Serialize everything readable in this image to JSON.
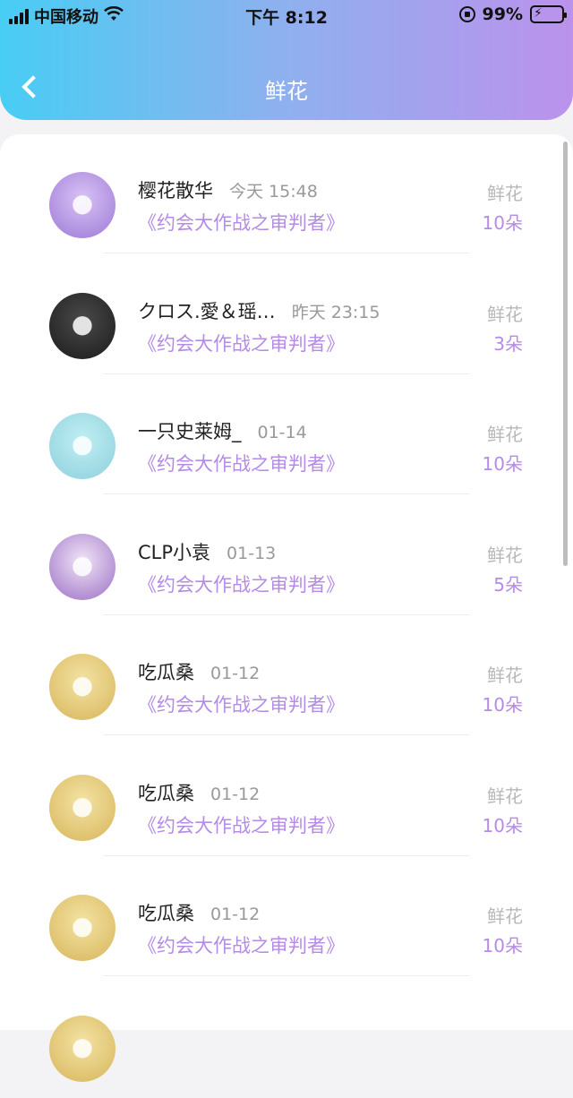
{
  "status": {
    "carrier": "中国移动",
    "time": "下午 8:12",
    "battery": "99%",
    "battery_level": 0.99
  },
  "nav": {
    "title": "鲜花"
  },
  "rows": [
    {
      "name": "樱花散华",
      "time": "今天 15:48",
      "gift": "《约会大作战之审判者》",
      "gift_label": "鲜花",
      "count": "10朵",
      "avatar_colors": [
        "#d9c3f5",
        "#9b78d6"
      ]
    },
    {
      "name": "クロス.愛＆瑶…",
      "time": "昨天 23:15",
      "gift": "《约会大作战之审判者》",
      "gift_label": "鲜花",
      "count": "3朵",
      "avatar_colors": [
        "#4a4a4a",
        "#1b1b1b"
      ]
    },
    {
      "name": "一只史莱姆_",
      "time": "01-14",
      "gift": "《约会大作战之审判者》",
      "gift_label": "鲜花",
      "count": "10朵",
      "avatar_colors": [
        "#bfeff3",
        "#8fcfdc"
      ]
    },
    {
      "name": "CLP小袁",
      "time": "01-13",
      "gift": "《约会大作战之审判者》",
      "gift_label": "鲜花",
      "count": "5朵",
      "avatar_colors": [
        "#f1e4f7",
        "#9a6fc4"
      ]
    },
    {
      "name": "吃瓜桑",
      "time": "01-12",
      "gift": "《约会大作战之审判者》",
      "gift_label": "鲜花",
      "count": "10朵",
      "avatar_colors": [
        "#f4e3a4",
        "#d6b55a"
      ]
    },
    {
      "name": "吃瓜桑",
      "time": "01-12",
      "gift": "《约会大作战之审判者》",
      "gift_label": "鲜花",
      "count": "10朵",
      "avatar_colors": [
        "#f4e3a4",
        "#d6b55a"
      ]
    },
    {
      "name": "吃瓜桑",
      "time": "01-12",
      "gift": "《约会大作战之审判者》",
      "gift_label": "鲜花",
      "count": "10朵",
      "avatar_colors": [
        "#f4e3a4",
        "#d6b55a"
      ]
    },
    {
      "name": "",
      "time": "",
      "gift": "",
      "gift_label": "",
      "count": "",
      "avatar_colors": [
        "#f4e3a4",
        "#d6b55a"
      ]
    }
  ],
  "colors": {
    "header_gradient": [
      "#48cdf4",
      "#bb92ec"
    ],
    "accent": "#b48be6",
    "muted": "#999999"
  }
}
